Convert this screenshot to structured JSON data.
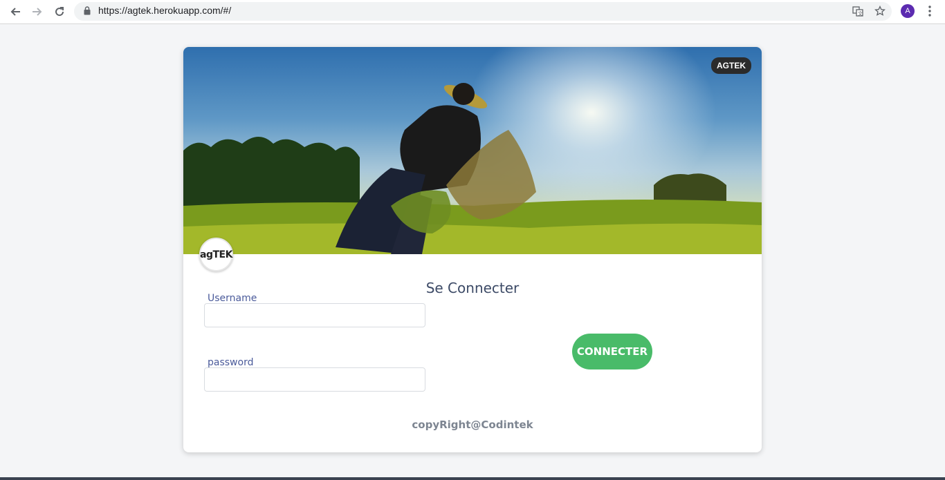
{
  "browser": {
    "url": "https://agtek.herokuapp.com/#/",
    "avatar_letter": "A",
    "icons": [
      "back-arrow-icon",
      "forward-arrow-icon",
      "reload-icon",
      "lock-icon",
      "translate-icon",
      "star-icon",
      "menu-dots-icon"
    ]
  },
  "card": {
    "badge": "AGTEK",
    "logo_text": "agTEK",
    "title": "Se Connecter",
    "username_label": "Username",
    "username_value": "",
    "password_label": "password",
    "password_value": "",
    "submit_label": "CONNECTER",
    "footer": "copyRight@Codintek"
  },
  "colors": {
    "button": "#49bb69",
    "title": "#3c4a66",
    "label": "#4a5a9a",
    "badge_bg": "#2b2b2b",
    "page_bg": "#f4f5f7"
  }
}
